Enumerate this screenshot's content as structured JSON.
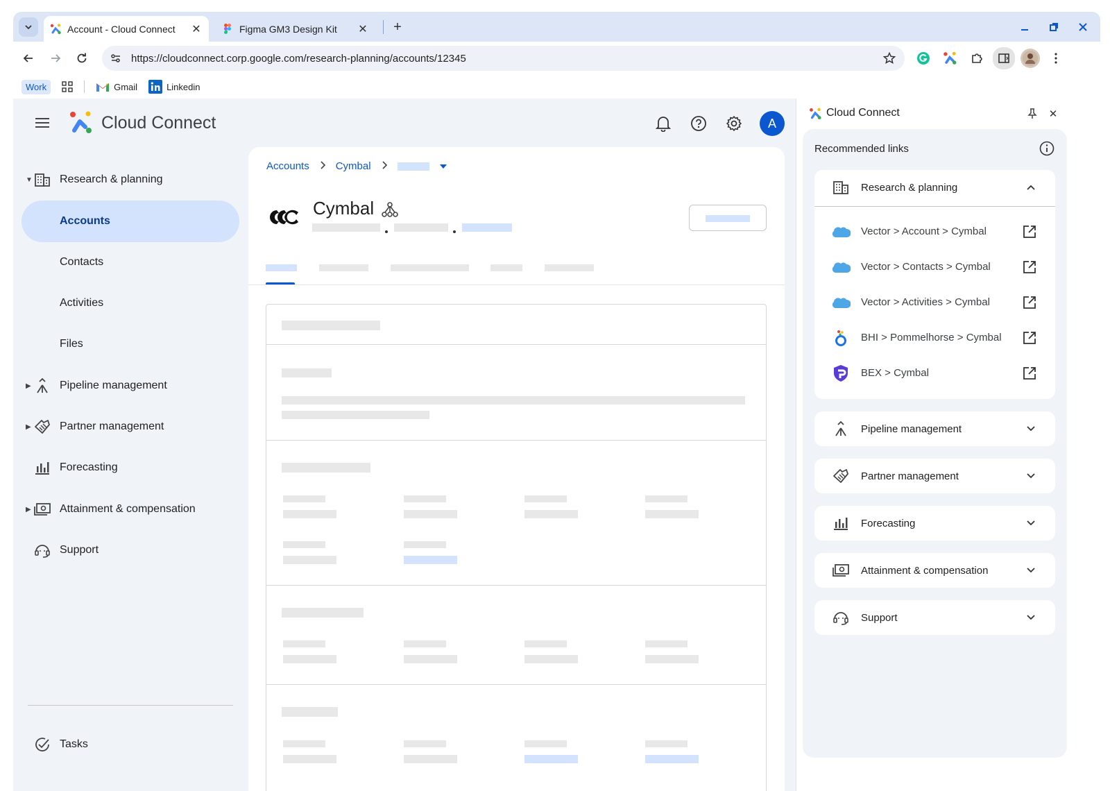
{
  "browser": {
    "tabs": [
      {
        "title": "Account - Cloud Connect",
        "active": true
      },
      {
        "title": "Figma GM3 Design Kit",
        "active": false
      }
    ],
    "new_tab": "+",
    "url": "https://cloudconnect.corp.google.com/research-planning/accounts/12345",
    "bookmarks": {
      "work": "Work",
      "gmail": "Gmail",
      "linkedin": "Linkedin"
    }
  },
  "app": {
    "name": "Cloud Connect",
    "avatar_letter": "A"
  },
  "leftnav": {
    "research": "Research & planning",
    "sub": [
      "Accounts",
      "Contacts",
      "Activities",
      "Files"
    ],
    "pipeline": "Pipeline management",
    "partner": "Partner management",
    "forecasting": "Forecasting",
    "attainment": "Attainment & compensation",
    "support": "Support",
    "tasks": "Tasks"
  },
  "main": {
    "breadcrumb": [
      "Accounts",
      "Cymbal"
    ],
    "account_name": "Cymbal"
  },
  "side_panel": {
    "title": "Cloud Connect",
    "recommended": "Recommended links",
    "sections": [
      {
        "label": "Research & planning",
        "expanded": true,
        "links": [
          {
            "label": "Vector > Account > Cymbal",
            "icon": "salesforce-cloud-icon"
          },
          {
            "label": "Vector > Contacts > Cymbal",
            "icon": "salesforce-cloud-icon"
          },
          {
            "label": "Vector > Activities > Cymbal",
            "icon": "salesforce-cloud-icon"
          },
          {
            "label": "BHI > Pommelhorse > Cymbal",
            "icon": "bhi-icon"
          },
          {
            "label": "BEX > Cymbal",
            "icon": "bex-shield-icon"
          }
        ]
      },
      {
        "label": "Pipeline management",
        "expanded": false
      },
      {
        "label": "Partner management",
        "expanded": false
      },
      {
        "label": "Forecasting",
        "expanded": false
      },
      {
        "label": "Attainment & compensation",
        "expanded": false
      },
      {
        "label": "Support",
        "expanded": false
      }
    ]
  },
  "colors": {
    "accent": "#0b57d0",
    "selected_bg": "#d3e3fd",
    "skeleton": "#e8e8e8",
    "browser_frame": "#dde6f6"
  }
}
